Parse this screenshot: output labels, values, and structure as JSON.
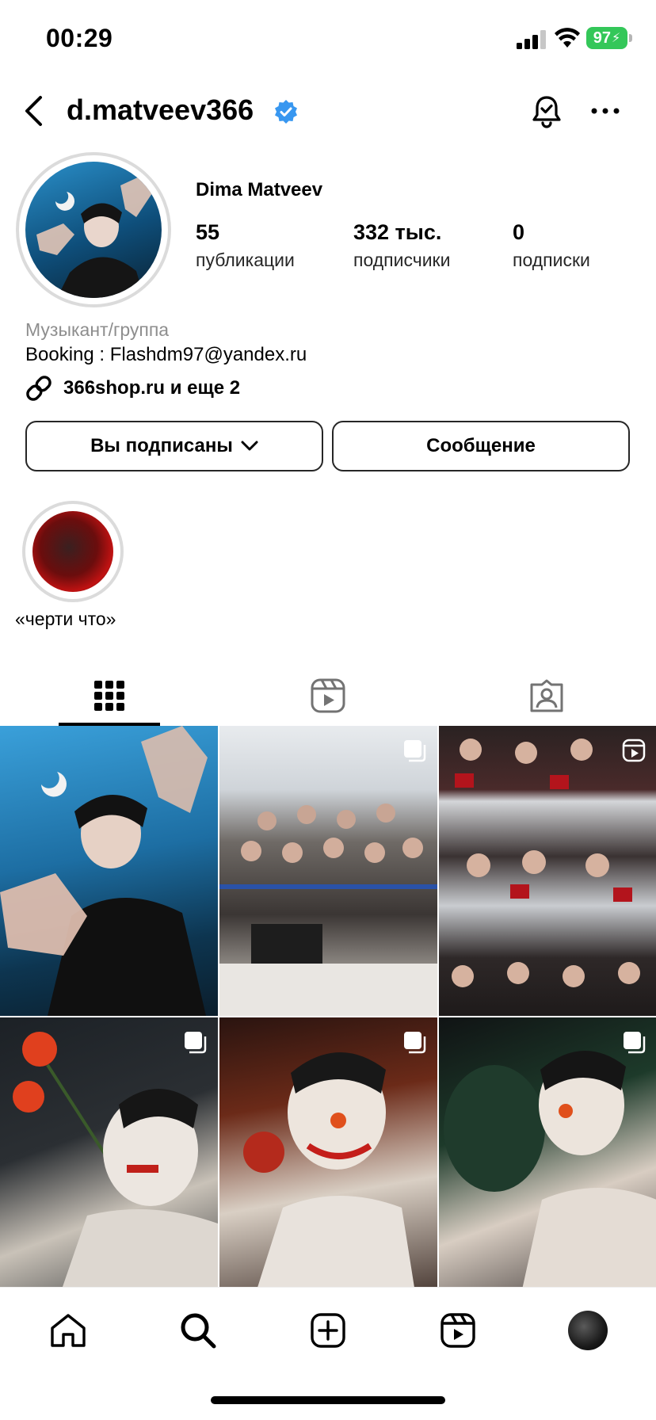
{
  "status_bar": {
    "time": "00:29",
    "battery": "97"
  },
  "header": {
    "username": "d.matveev366"
  },
  "profile": {
    "display_name": "Dima Matveev",
    "stats": {
      "posts": {
        "value": "55",
        "label": "публикации"
      },
      "followers": {
        "value": "332 тыс.",
        "label": "подписчики"
      },
      "following": {
        "value": "0",
        "label": "подписки"
      }
    },
    "category": "Музыкант/группа",
    "bio": "Booking : Flashdm97@yandex.ru",
    "link": "366shop.ru и еще 2"
  },
  "actions": {
    "following_label": "Вы подписаны",
    "message_label": "Сообщение"
  },
  "highlights": [
    {
      "label": "«черти что»"
    }
  ],
  "tabs": [
    {
      "icon": "grid-icon",
      "active": true
    },
    {
      "icon": "reels-icon",
      "active": false
    },
    {
      "icon": "tagged-icon",
      "active": false
    }
  ],
  "posts": [
    {
      "type": "photo",
      "badge": "none"
    },
    {
      "type": "carousel",
      "badge": "carousel-icon"
    },
    {
      "type": "reel",
      "badge": "reel-icon"
    },
    {
      "type": "carousel",
      "badge": "carousel-icon"
    },
    {
      "type": "carousel",
      "badge": "carousel-icon"
    },
    {
      "type": "carousel",
      "badge": "carousel-icon"
    }
  ],
  "bottom_nav": [
    "home-icon",
    "search-icon",
    "create-icon",
    "reels-icon",
    "profile-avatar"
  ],
  "colors": {
    "verified": "#3897f0",
    "battery": "#34c759"
  }
}
